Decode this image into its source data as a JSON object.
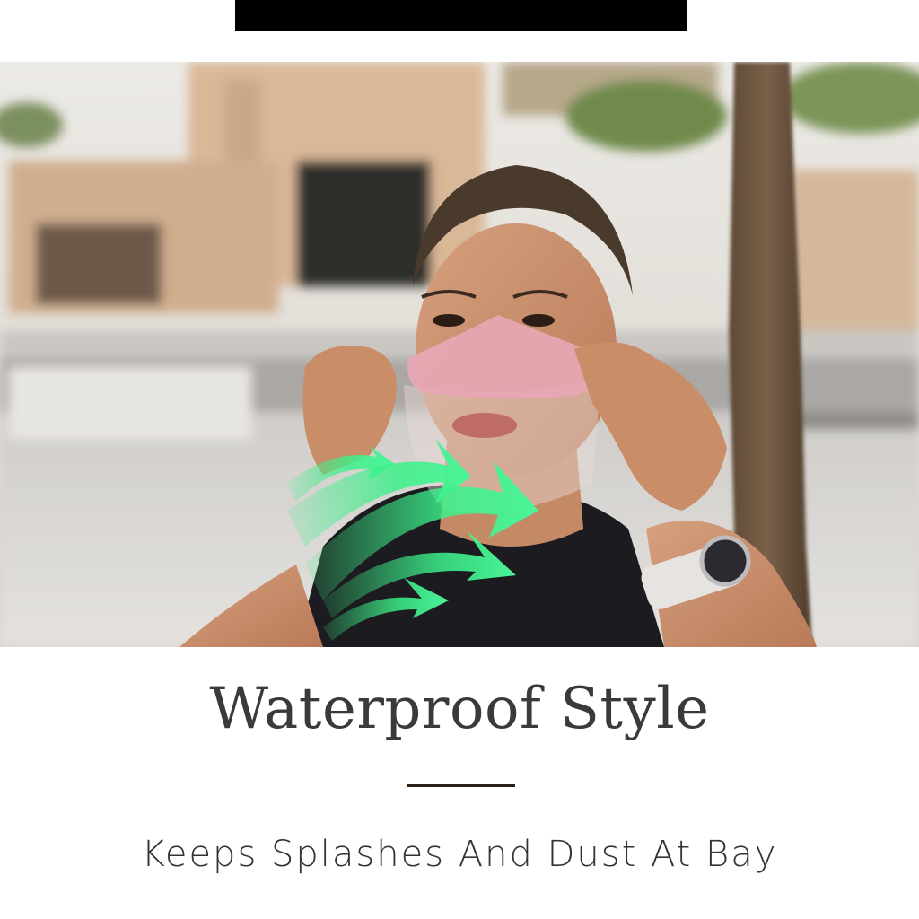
{
  "heading": {
    "title": "Waterproof Style",
    "subtitle": "Keeps Splashes And Dust At Bay"
  },
  "colors": {
    "top_bar": "#000000",
    "arrow_green": "#3cf08a",
    "title_text": "#3a3a3a",
    "divider": "#2a2018"
  },
  "icons": {
    "airflow": "green-airflow-arrows-icon"
  }
}
